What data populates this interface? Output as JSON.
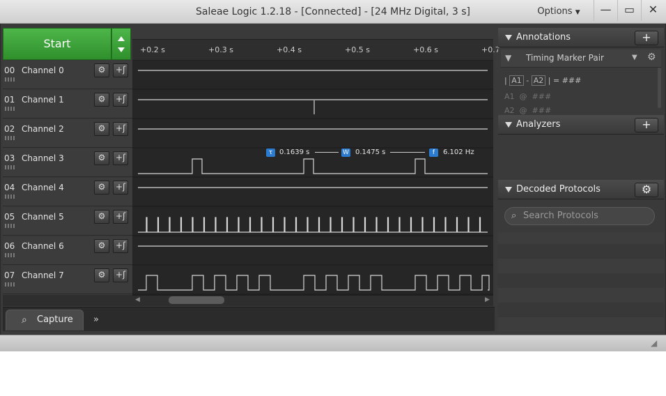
{
  "window": {
    "title": "Saleae Logic 1.2.18 - [Connected] - [24 MHz Digital, 3 s]",
    "options_label": "Options",
    "minimize_glyph": "—",
    "maximize_glyph": "▭",
    "close_glyph": "✕"
  },
  "start_button": {
    "label": "Start"
  },
  "channels": [
    {
      "num": "00",
      "name": "Channel 0",
      "color": "#3b3b3b"
    },
    {
      "num": "01",
      "name": "Channel 1",
      "color": "#8b5a2b"
    },
    {
      "num": "02",
      "name": "Channel 2",
      "color": "#d0202a"
    },
    {
      "num": "03",
      "name": "Channel 3",
      "color": "#f07d1a"
    },
    {
      "num": "04",
      "name": "Channel 4",
      "color": "#e8c21e"
    },
    {
      "num": "05",
      "name": "Channel 5",
      "color": "#39a83a"
    },
    {
      "num": "06",
      "name": "Channel 6",
      "color": "#2d55c6"
    },
    {
      "num": "07",
      "name": "Channel 7",
      "color": "#8a3fb3"
    }
  ],
  "channel_buttons": {
    "settings_glyph": "⚙",
    "add_glyph": "+ʃ"
  },
  "timeline": {
    "ticks": [
      "+0.2 s",
      "+0.3 s",
      "+0.4 s",
      "+0.5 s",
      "+0.6 s",
      "+0.7"
    ]
  },
  "measurements": {
    "period_icon": "τ",
    "period": "0.1639 s",
    "width_icon": "W",
    "width": "0.1475 s",
    "freq_icon": "f",
    "frequency": "6.102 Hz"
  },
  "bottom_tabs": {
    "capture_label": "Capture",
    "more_glyph": "»"
  },
  "annotations": {
    "header": "Annotations",
    "add_glyph": "+",
    "marker_pair": "Timing Marker Pair",
    "formula": {
      "left": "|",
      "a1": "A1",
      "dash": "-",
      "a2": "A2",
      "right": "| = ###"
    },
    "a1_line": "A1  @  ###",
    "a2_line": "A2  @  ###"
  },
  "analyzers": {
    "header": "Analyzers",
    "add_glyph": "+"
  },
  "decoded_protocols": {
    "header": "Decoded Protocols",
    "gear_glyph": "⚙",
    "search_placeholder": "Search Protocols"
  },
  "colors": {
    "accent_green": "#3aa537",
    "marker_blue": "#2b7cd0",
    "trace": "#d8d8d8"
  }
}
